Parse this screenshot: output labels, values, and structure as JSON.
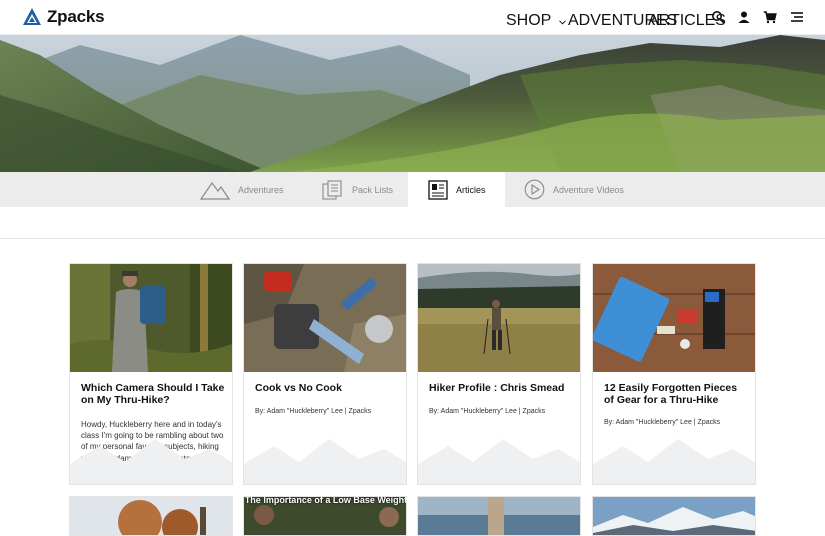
{
  "brand": {
    "name": "Zpacks"
  },
  "nav": {
    "shop": "SHOP",
    "adventures": "ADVENTURES",
    "articles": "ARTICLES",
    "icons": [
      "search-icon",
      "account-icon",
      "cart-icon",
      "menu-icon"
    ]
  },
  "tabs": [
    {
      "label": "Adventures",
      "icon": "mountain-icon"
    },
    {
      "label": "Pack Lists",
      "icon": "list-icon"
    },
    {
      "label": "Articles",
      "icon": "newspaper-icon",
      "active": true
    },
    {
      "label": "Adventure Videos",
      "icon": "play-icon"
    }
  ],
  "cards": [
    {
      "title": "Which Camera Should I Take on My Thru-Hike?",
      "excerpt": "Howdy, Huckleberry here and in today's class I'm going to be rambling about two of my personal favorite subjects, hiking your own damn hike and photography. We live in a..."
    },
    {
      "title": "Cook vs No Cook",
      "byline": "By: Adam \"Huckleberry\" Lee | Zpacks"
    },
    {
      "title": "Hiker Profile : Chris Smead",
      "byline": "By: Adam \"Huckleberry\" Lee | Zpacks"
    },
    {
      "title": "12 Easily Forgotten Pieces of Gear for a Thru-Hike",
      "byline": "By: Adam \"Huckleberry\" Lee | Zpacks"
    }
  ],
  "next_row": {
    "card2_overlay": "The Importance of a Low Base Weight"
  },
  "colors": {
    "brand_blue": "#1f5fa8",
    "tab_bar": "#ececec",
    "text": "#111111"
  }
}
